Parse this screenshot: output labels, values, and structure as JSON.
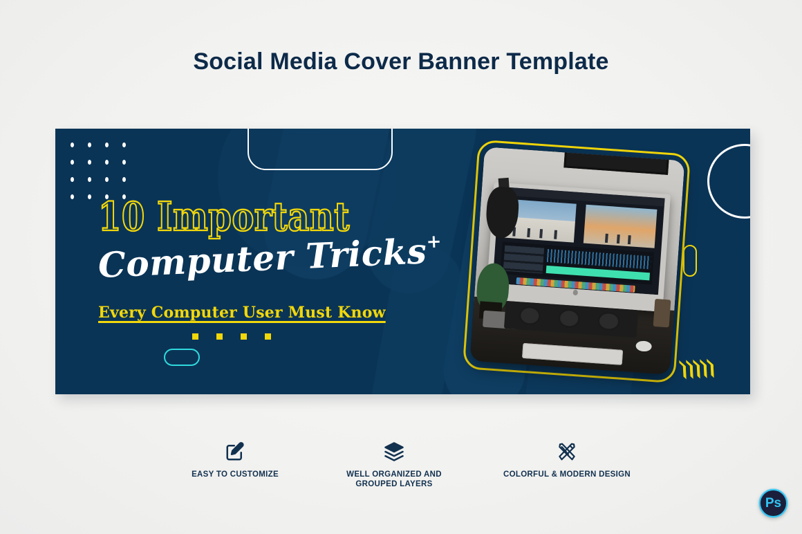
{
  "page": {
    "title": "Social Media Cover Banner Template",
    "background_color": "#f4f4f2"
  },
  "banner": {
    "background_color": "#0a3456",
    "accent_yellow": "#f2d70a",
    "accent_cyan": "#2fd9dd",
    "headline_line1": "10 Important",
    "headline_line2": "Computer Tricks",
    "headline_line2_suffix": "+",
    "headline_line3": "Every Computer User Must Know",
    "decorations": {
      "dot_grid": "dot-grid-4x4",
      "top_outline": "rounded-rect-outline",
      "right_circle": "circle-outline",
      "yellow_capsule": "capsule-outline",
      "cyan_pill": "pill-outline",
      "squares_count": 4,
      "chevrons_top": ">>>>>",
      "chevrons_bottom": ">>>>>"
    },
    "photo": {
      "alt": "iMac video editing workstation on desk with control surface and keyboard",
      "frame_color": "#f2d70a"
    }
  },
  "features": [
    {
      "icon": "edit-square-pencil-icon",
      "label": "EASY TO CUSTOMIZE"
    },
    {
      "icon": "layers-stack-icon",
      "label": "WELL ORGANIZED AND\nGROUPED LAYERS"
    },
    {
      "icon": "pencil-ruler-cross-icon",
      "label": "COLORFUL & MODERN DESIGN"
    }
  ],
  "badge": {
    "label": "Ps",
    "ring_color": "#31c5f4",
    "fill_color": "#1b1f3b"
  }
}
